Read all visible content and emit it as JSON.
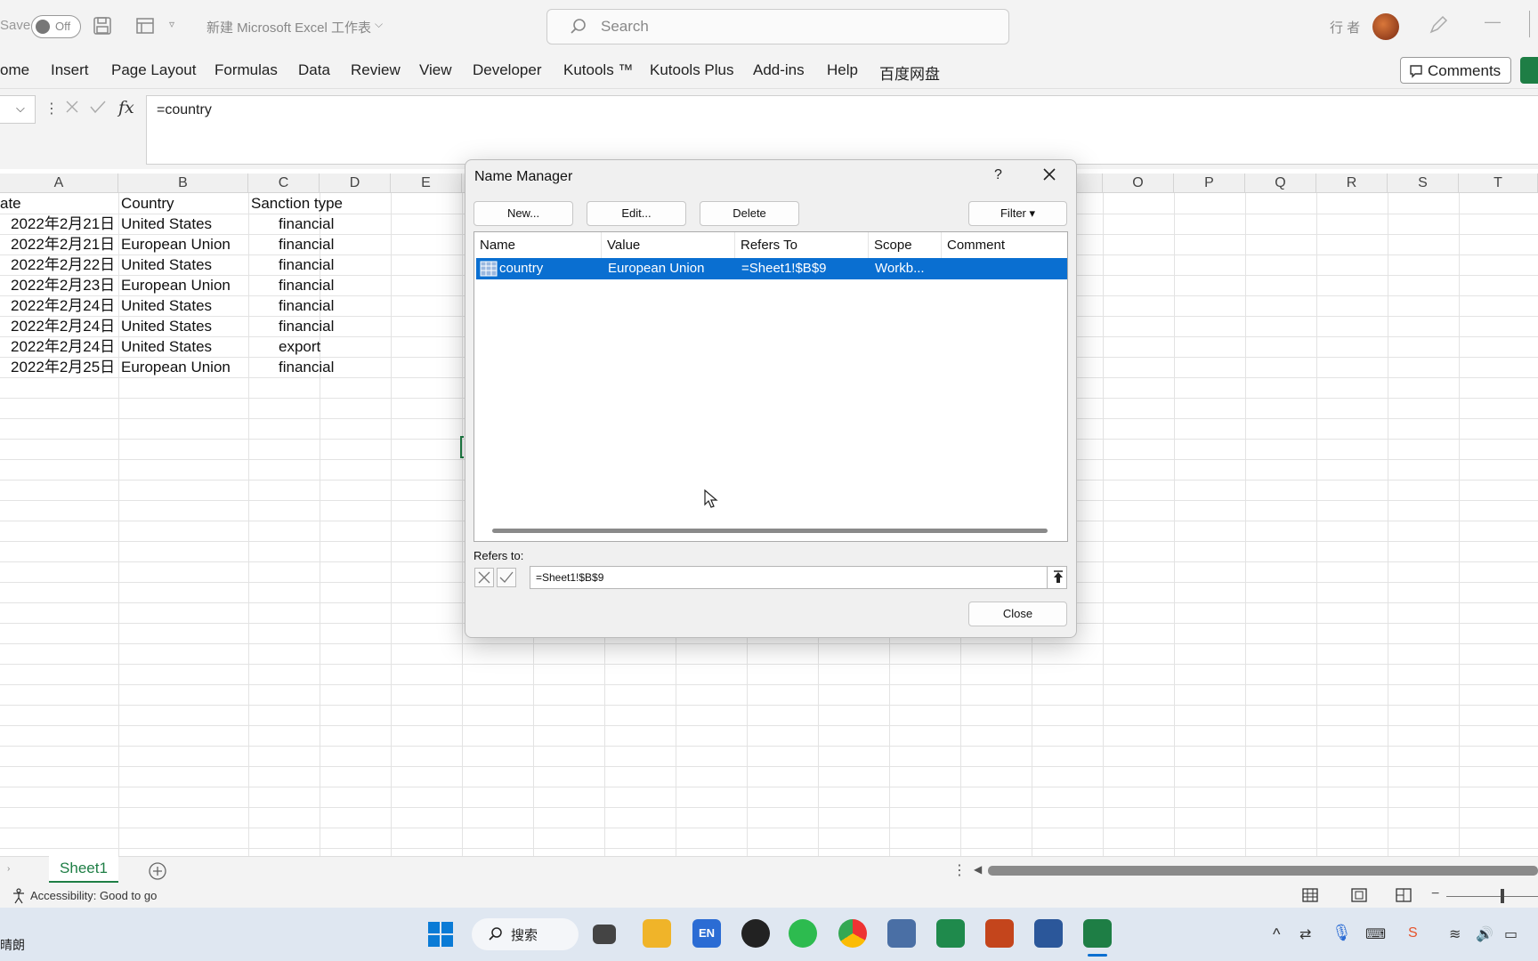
{
  "titlebar": {
    "autosave_label": "Save",
    "autosave_state": "Off",
    "file_name": "新建 Microsoft Excel 工作表",
    "search_placeholder": "Search",
    "user_name": "行 者"
  },
  "ribbon": {
    "tabs": [
      "ome",
      "Insert",
      "Page Layout",
      "Formulas",
      "Data",
      "Review",
      "View",
      "Developer",
      "Kutools ™",
      "Kutools Plus",
      "Add-ins",
      "Help",
      "百度网盘"
    ],
    "comments_label": "Comments"
  },
  "formula_bar": {
    "fx": "fx",
    "value": "=country"
  },
  "grid": {
    "columns": [
      "A",
      "B",
      "C",
      "D",
      "E",
      "O",
      "P",
      "Q",
      "R",
      "S",
      "T"
    ],
    "header_row": [
      "ate",
      "Country",
      "Sanction type"
    ],
    "rows": [
      [
        "2022年2月21日",
        "United States",
        "financial"
      ],
      [
        "2022年2月21日",
        "European Union",
        "financial"
      ],
      [
        "2022年2月22日",
        "United States",
        "financial"
      ],
      [
        "2022年2月23日",
        "European Union",
        "financial"
      ],
      [
        "2022年2月24日",
        "United States",
        "financial"
      ],
      [
        "2022年2月24日",
        "United States",
        "financial"
      ],
      [
        "2022年2月24日",
        "United States",
        "export"
      ],
      [
        "2022年2月25日",
        "European Union",
        "financial"
      ]
    ]
  },
  "sheet_tabs": [
    "Sheet1"
  ],
  "status": {
    "accessibility": "Accessibility: Good to go"
  },
  "taskbar": {
    "weather": "晴朗",
    "search_label": "搜索"
  },
  "dialog": {
    "title": "Name Manager",
    "help": "?",
    "buttons": {
      "new": "New...",
      "edit": "Edit...",
      "delete": "Delete",
      "filter": "Filter ▾",
      "close": "Close"
    },
    "columns": [
      "Name",
      "Value",
      "Refers To",
      "Scope",
      "Comment"
    ],
    "names": [
      {
        "name": "country",
        "value": "European Union",
        "refers_to": "=Sheet1!$B$9",
        "scope": "Workb...",
        "comment": ""
      }
    ],
    "refers_to_label": "Refers to:",
    "refers_to_value": "=Sheet1!$B$9"
  }
}
